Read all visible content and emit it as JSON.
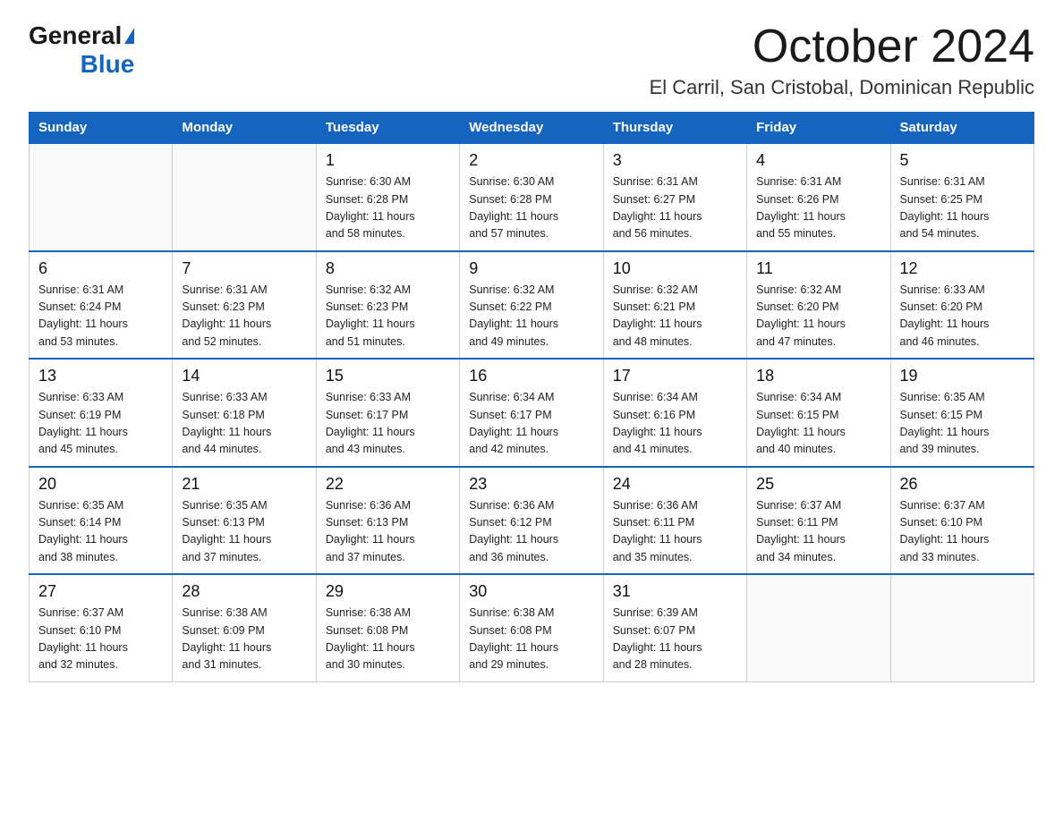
{
  "logo": {
    "general": "General",
    "blue": "Blue"
  },
  "header": {
    "title": "October 2024",
    "subtitle": "El Carril, San Cristobal, Dominican Republic"
  },
  "weekdays": [
    "Sunday",
    "Monday",
    "Tuesday",
    "Wednesday",
    "Thursday",
    "Friday",
    "Saturday"
  ],
  "weeks": [
    [
      {
        "day": "",
        "info": ""
      },
      {
        "day": "",
        "info": ""
      },
      {
        "day": "1",
        "info": "Sunrise: 6:30 AM\nSunset: 6:28 PM\nDaylight: 11 hours\nand 58 minutes."
      },
      {
        "day": "2",
        "info": "Sunrise: 6:30 AM\nSunset: 6:28 PM\nDaylight: 11 hours\nand 57 minutes."
      },
      {
        "day": "3",
        "info": "Sunrise: 6:31 AM\nSunset: 6:27 PM\nDaylight: 11 hours\nand 56 minutes."
      },
      {
        "day": "4",
        "info": "Sunrise: 6:31 AM\nSunset: 6:26 PM\nDaylight: 11 hours\nand 55 minutes."
      },
      {
        "day": "5",
        "info": "Sunrise: 6:31 AM\nSunset: 6:25 PM\nDaylight: 11 hours\nand 54 minutes."
      }
    ],
    [
      {
        "day": "6",
        "info": "Sunrise: 6:31 AM\nSunset: 6:24 PM\nDaylight: 11 hours\nand 53 minutes."
      },
      {
        "day": "7",
        "info": "Sunrise: 6:31 AM\nSunset: 6:23 PM\nDaylight: 11 hours\nand 52 minutes."
      },
      {
        "day": "8",
        "info": "Sunrise: 6:32 AM\nSunset: 6:23 PM\nDaylight: 11 hours\nand 51 minutes."
      },
      {
        "day": "9",
        "info": "Sunrise: 6:32 AM\nSunset: 6:22 PM\nDaylight: 11 hours\nand 49 minutes."
      },
      {
        "day": "10",
        "info": "Sunrise: 6:32 AM\nSunset: 6:21 PM\nDaylight: 11 hours\nand 48 minutes."
      },
      {
        "day": "11",
        "info": "Sunrise: 6:32 AM\nSunset: 6:20 PM\nDaylight: 11 hours\nand 47 minutes."
      },
      {
        "day": "12",
        "info": "Sunrise: 6:33 AM\nSunset: 6:20 PM\nDaylight: 11 hours\nand 46 minutes."
      }
    ],
    [
      {
        "day": "13",
        "info": "Sunrise: 6:33 AM\nSunset: 6:19 PM\nDaylight: 11 hours\nand 45 minutes."
      },
      {
        "day": "14",
        "info": "Sunrise: 6:33 AM\nSunset: 6:18 PM\nDaylight: 11 hours\nand 44 minutes."
      },
      {
        "day": "15",
        "info": "Sunrise: 6:33 AM\nSunset: 6:17 PM\nDaylight: 11 hours\nand 43 minutes."
      },
      {
        "day": "16",
        "info": "Sunrise: 6:34 AM\nSunset: 6:17 PM\nDaylight: 11 hours\nand 42 minutes."
      },
      {
        "day": "17",
        "info": "Sunrise: 6:34 AM\nSunset: 6:16 PM\nDaylight: 11 hours\nand 41 minutes."
      },
      {
        "day": "18",
        "info": "Sunrise: 6:34 AM\nSunset: 6:15 PM\nDaylight: 11 hours\nand 40 minutes."
      },
      {
        "day": "19",
        "info": "Sunrise: 6:35 AM\nSunset: 6:15 PM\nDaylight: 11 hours\nand 39 minutes."
      }
    ],
    [
      {
        "day": "20",
        "info": "Sunrise: 6:35 AM\nSunset: 6:14 PM\nDaylight: 11 hours\nand 38 minutes."
      },
      {
        "day": "21",
        "info": "Sunrise: 6:35 AM\nSunset: 6:13 PM\nDaylight: 11 hours\nand 37 minutes."
      },
      {
        "day": "22",
        "info": "Sunrise: 6:36 AM\nSunset: 6:13 PM\nDaylight: 11 hours\nand 37 minutes."
      },
      {
        "day": "23",
        "info": "Sunrise: 6:36 AM\nSunset: 6:12 PM\nDaylight: 11 hours\nand 36 minutes."
      },
      {
        "day": "24",
        "info": "Sunrise: 6:36 AM\nSunset: 6:11 PM\nDaylight: 11 hours\nand 35 minutes."
      },
      {
        "day": "25",
        "info": "Sunrise: 6:37 AM\nSunset: 6:11 PM\nDaylight: 11 hours\nand 34 minutes."
      },
      {
        "day": "26",
        "info": "Sunrise: 6:37 AM\nSunset: 6:10 PM\nDaylight: 11 hours\nand 33 minutes."
      }
    ],
    [
      {
        "day": "27",
        "info": "Sunrise: 6:37 AM\nSunset: 6:10 PM\nDaylight: 11 hours\nand 32 minutes."
      },
      {
        "day": "28",
        "info": "Sunrise: 6:38 AM\nSunset: 6:09 PM\nDaylight: 11 hours\nand 31 minutes."
      },
      {
        "day": "29",
        "info": "Sunrise: 6:38 AM\nSunset: 6:08 PM\nDaylight: 11 hours\nand 30 minutes."
      },
      {
        "day": "30",
        "info": "Sunrise: 6:38 AM\nSunset: 6:08 PM\nDaylight: 11 hours\nand 29 minutes."
      },
      {
        "day": "31",
        "info": "Sunrise: 6:39 AM\nSunset: 6:07 PM\nDaylight: 11 hours\nand 28 minutes."
      },
      {
        "day": "",
        "info": ""
      },
      {
        "day": "",
        "info": ""
      }
    ]
  ]
}
